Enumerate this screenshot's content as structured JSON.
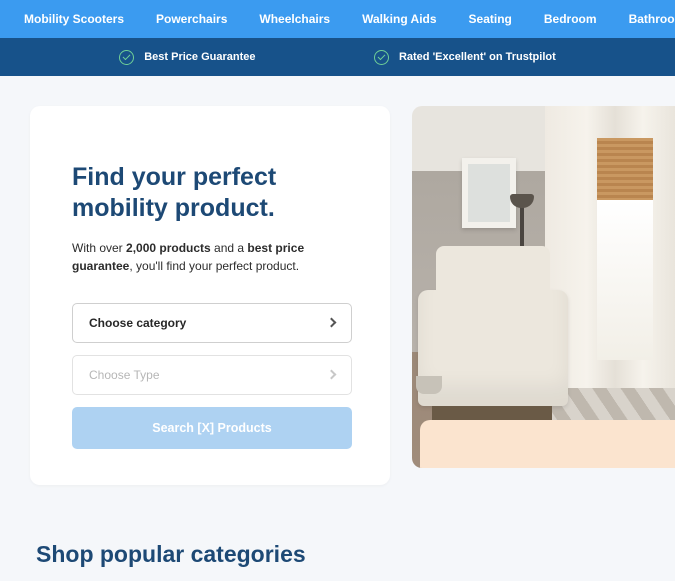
{
  "nav": {
    "items": [
      {
        "label": "Mobility Scooters"
      },
      {
        "label": "Powerchairs"
      },
      {
        "label": "Wheelchairs"
      },
      {
        "label": "Walking Aids"
      },
      {
        "label": "Seating"
      },
      {
        "label": "Bedroom"
      },
      {
        "label": "Bathroom"
      }
    ]
  },
  "trustbar": {
    "items": [
      {
        "label": "Best Price Guarantee"
      },
      {
        "label": "Rated 'Excellent' on Trustpilot"
      }
    ]
  },
  "hero": {
    "title": "Find your perfect mobility product.",
    "desc_pre": "With over ",
    "desc_bold1": "2,000 products",
    "desc_mid": " and a ",
    "desc_bold2": "best price guarantee",
    "desc_post": ", you'll find your perfect product.",
    "select_category": "Choose category",
    "select_type": "Choose Type",
    "search_button": "Search [X] Products"
  },
  "section": {
    "popular_title": "Shop popular categories"
  }
}
